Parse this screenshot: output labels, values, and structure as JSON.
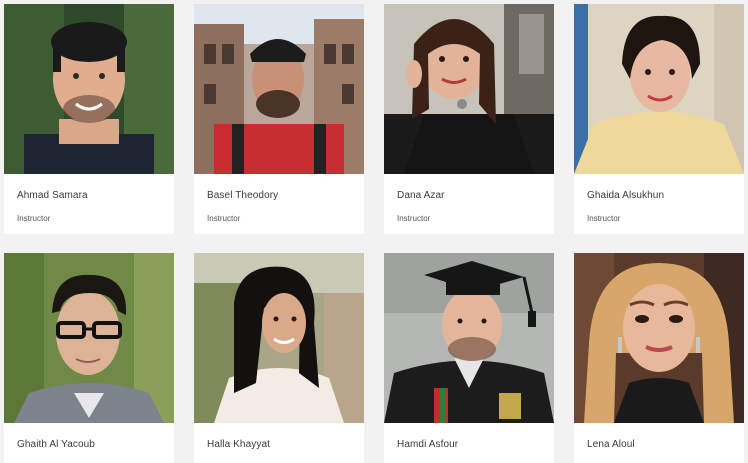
{
  "instructors": [
    {
      "name": "Ahmad Samara",
      "role": "Instructor"
    },
    {
      "name": "Basel Theodory",
      "role": "Instructor"
    },
    {
      "name": "Dana Azar",
      "role": "Instructor"
    },
    {
      "name": "Ghaida Alsukhun",
      "role": "Instructor"
    },
    {
      "name": "Ghaith Al Yacoub",
      "role": ""
    },
    {
      "name": "Halla Khayyat",
      "role": ""
    },
    {
      "name": "Hamdi Asfour",
      "role": ""
    },
    {
      "name": "Lena Aloul",
      "role": ""
    }
  ]
}
